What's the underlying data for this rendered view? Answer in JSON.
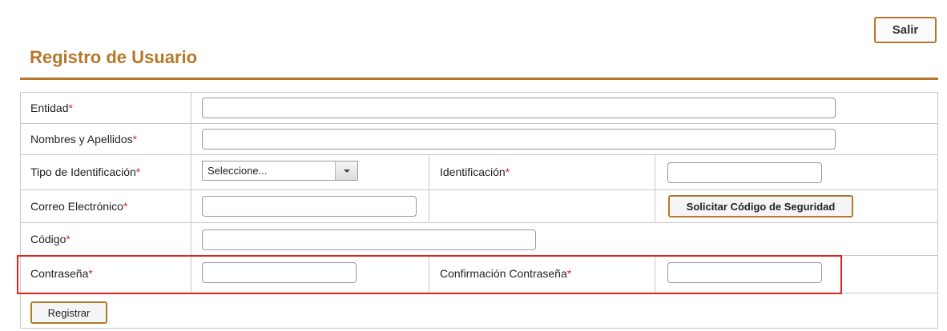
{
  "header": {
    "exit_label": "Salir",
    "title": "Registro de Usuario"
  },
  "form": {
    "entidad_label": "Entidad",
    "nombres_label": "Nombres y Apellidos",
    "tipo_id_label": "Tipo de Identificación",
    "tipo_id_selected": "Seleccione...",
    "identificacion_label": "Identificación",
    "correo_label": "Correo Electrónico",
    "solicitar_label": "Solicitar Código de Seguridad",
    "codigo_label": "Código",
    "contrasena_label": "Contraseña",
    "confirmacion_label": "Confirmación Contraseña",
    "registrar_label": "Registrar",
    "required_mark": "*"
  },
  "colors": {
    "accent": "#b5782a",
    "required": "#d9242b",
    "highlight": "#e2231a"
  }
}
